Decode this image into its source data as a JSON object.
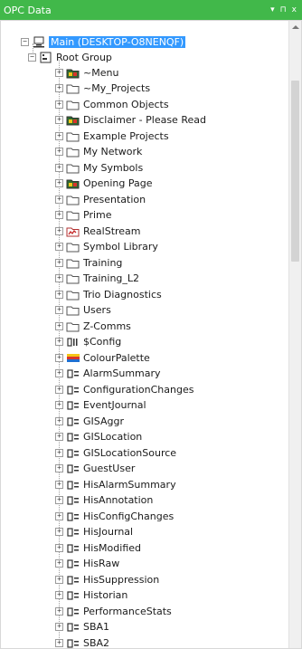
{
  "window": {
    "title": "OPC Data",
    "controls": [
      "▾",
      "⊓",
      "x"
    ]
  },
  "tree": {
    "root": "Main (DESKTOP-O8NENQF)",
    "group": "Root Group",
    "items": [
      {
        "label": "~Menu",
        "icon": "special-folder-icon"
      },
      {
        "label": "~My_Projects",
        "icon": "folder-icon"
      },
      {
        "label": "Common Objects",
        "icon": "folder-icon"
      },
      {
        "label": "Disclaimer - Please Read",
        "icon": "special-folder-icon"
      },
      {
        "label": "Example Projects",
        "icon": "folder-icon"
      },
      {
        "label": "My Network",
        "icon": "folder-icon"
      },
      {
        "label": "My Symbols",
        "icon": "folder-icon"
      },
      {
        "label": "Opening Page",
        "icon": "special-folder-icon"
      },
      {
        "label": "Presentation",
        "icon": "folder-icon"
      },
      {
        "label": "Prime",
        "icon": "folder-icon"
      },
      {
        "label": "RealStream",
        "icon": "realstream-icon"
      },
      {
        "label": "Symbol Library",
        "icon": "folder-icon"
      },
      {
        "label": "Training",
        "icon": "folder-icon"
      },
      {
        "label": "Training_L2",
        "icon": "folder-icon"
      },
      {
        "label": "Trio Diagnostics",
        "icon": "folder-icon"
      },
      {
        "label": "Users",
        "icon": "folder-icon"
      },
      {
        "label": "Z-Comms",
        "icon": "folder-icon"
      },
      {
        "label": "$Config",
        "icon": "config-icon"
      },
      {
        "label": "ColourPalette",
        "icon": "palette-icon"
      },
      {
        "label": "AlarmSummary",
        "icon": "data-table-icon"
      },
      {
        "label": "ConfigurationChanges",
        "icon": "data-table-icon"
      },
      {
        "label": "EventJournal",
        "icon": "data-table-icon"
      },
      {
        "label": "GISAggr",
        "icon": "data-table-icon"
      },
      {
        "label": "GISLocation",
        "icon": "data-table-icon"
      },
      {
        "label": "GISLocationSource",
        "icon": "data-table-icon"
      },
      {
        "label": "GuestUser",
        "icon": "data-table-icon"
      },
      {
        "label": "HisAlarmSummary",
        "icon": "data-table-icon"
      },
      {
        "label": "HisAnnotation",
        "icon": "data-table-icon"
      },
      {
        "label": "HisConfigChanges",
        "icon": "data-table-icon"
      },
      {
        "label": "HisJournal",
        "icon": "data-table-icon"
      },
      {
        "label": "HisModified",
        "icon": "data-table-icon"
      },
      {
        "label": "HisRaw",
        "icon": "data-table-icon"
      },
      {
        "label": "HisSuppression",
        "icon": "data-table-icon"
      },
      {
        "label": "Historian",
        "icon": "data-table-icon"
      },
      {
        "label": "PerformanceStats",
        "icon": "data-table-icon"
      },
      {
        "label": "SBA1",
        "icon": "data-table-icon"
      },
      {
        "label": "SBA2",
        "icon": "data-table-icon"
      }
    ]
  },
  "colors": {
    "titlebar": "#41b84a",
    "selection": "#3399ff",
    "folder": "#e8c35a"
  }
}
